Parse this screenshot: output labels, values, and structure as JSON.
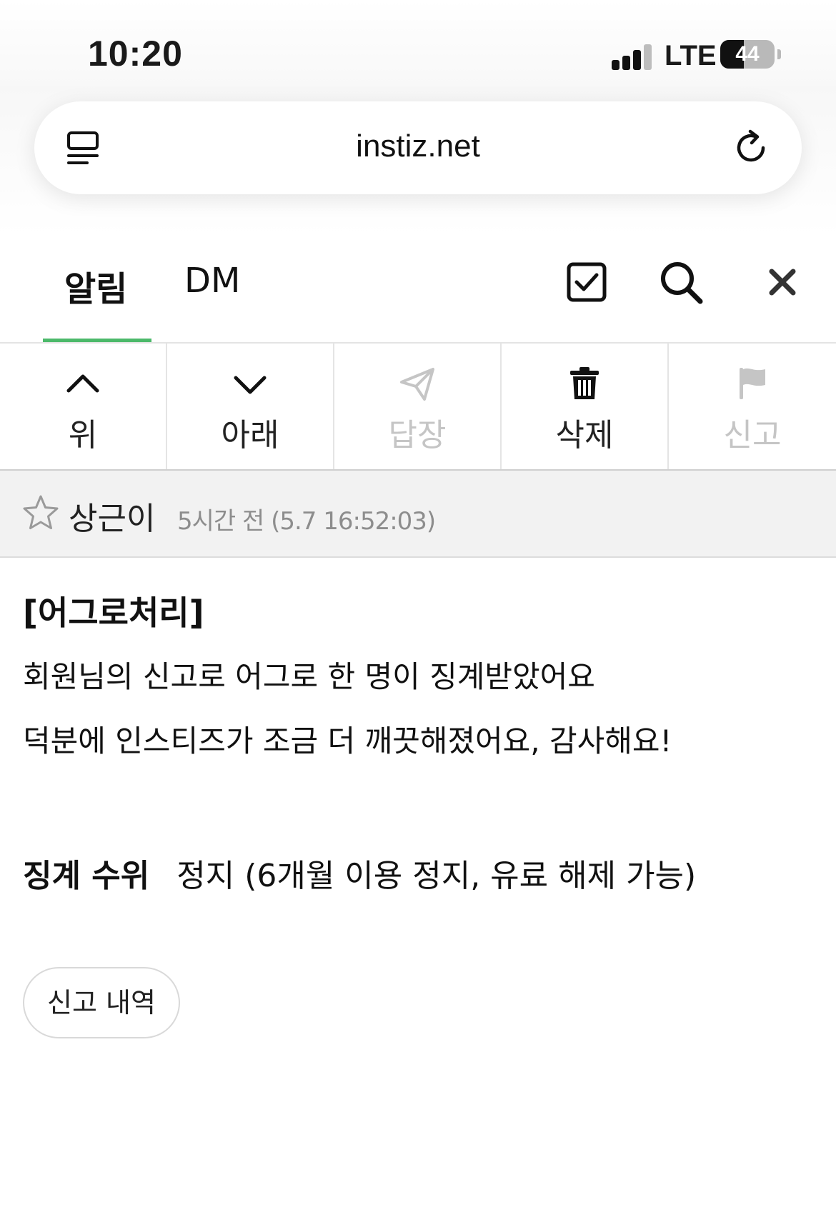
{
  "status_bar": {
    "time": "10:20",
    "network": "LTE",
    "battery_percent": "44",
    "battery_level": 0.44
  },
  "browser": {
    "url": "instiz.net",
    "reader_icon": "reader-mode-icon",
    "reload_icon": "reload-icon"
  },
  "tabs": {
    "items": [
      {
        "label": "알림",
        "active": true
      },
      {
        "label": "DM",
        "active": false
      }
    ],
    "accent_color": "#4cb96a",
    "icons": [
      "checkbox-icon",
      "search-icon",
      "close-icon"
    ]
  },
  "toolbar": {
    "items": [
      {
        "label": "위",
        "icon": "chevron-up-icon",
        "enabled": true
      },
      {
        "label": "아래",
        "icon": "chevron-down-icon",
        "enabled": true
      },
      {
        "label": "답장",
        "icon": "paper-plane-icon",
        "enabled": false
      },
      {
        "label": "삭제",
        "icon": "trash-icon",
        "enabled": true
      },
      {
        "label": "신고",
        "icon": "flag-icon",
        "enabled": false
      }
    ]
  },
  "message": {
    "sender": "상근이",
    "time": "5시간 전 (5.7 16:52:03)",
    "title": "[어그로처리]",
    "lines": [
      "회원님의 신고로 어그로 한 명이 징계받았어요",
      "덕분에 인스티즈가 조금 더 깨끗해졌어요, 감사해요!"
    ],
    "penalty_label": "징계 수위",
    "penalty_value": "정지 (6개월 이용 정지, 유료 해제 가능)",
    "report_history_button": "신고 내역"
  }
}
